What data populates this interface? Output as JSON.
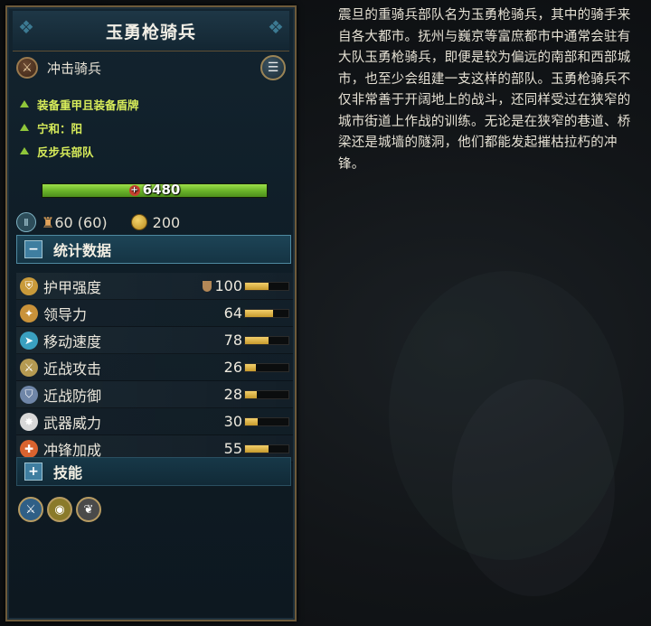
{
  "unit": {
    "name": "玉勇枪骑兵",
    "type": "冲击骑兵",
    "type_icon": "cavalry-charge-icon",
    "menu_icon": "list-menu-icon",
    "traits": [
      "装备重甲且装备盾牌",
      "宁和：阳",
      "反步兵部队"
    ],
    "health": "6480",
    "health_fraction": 1.0,
    "upkeep": "60 (60)",
    "cost": "200"
  },
  "sections": {
    "stats_label": "统计数据",
    "skills_label": "技能"
  },
  "stats": [
    {
      "label": "护甲强度",
      "value": "100",
      "fill": 0.55,
      "icon": "armor-icon",
      "color": "#c99a3a"
    },
    {
      "label": "领导力",
      "value": "64",
      "fill": 0.64,
      "icon": "leadership-icon",
      "color": "#c9923a"
    },
    {
      "label": "移动速度",
      "value": "78",
      "fill": 0.55,
      "icon": "speed-icon",
      "color": "#3aa0c0"
    },
    {
      "label": "近战攻击",
      "value": "26",
      "fill": 0.26,
      "icon": "melee-attack-icon",
      "color": "#b59a52"
    },
    {
      "label": "近战防御",
      "value": "28",
      "fill": 0.28,
      "icon": "melee-defense-icon",
      "color": "#6f86a8"
    },
    {
      "label": "武器威力",
      "value": "30",
      "fill": 0.3,
      "icon": "weapon-strength-icon",
      "color": "#d8d8d8"
    },
    {
      "label": "冲锋加成",
      "value": "55",
      "fill": 0.55,
      "icon": "charge-bonus-icon",
      "color": "#d9632f"
    }
  ],
  "abilities": [
    {
      "icon": "sword-ability-icon",
      "color": "#2f5f86"
    },
    {
      "icon": "eye-ability-icon",
      "color": "#8a7a2a"
    },
    {
      "icon": "feather-ability-icon",
      "color": "#4a4a4a"
    }
  ],
  "description": "震旦的重骑兵部队名为玉勇枪骑兵，其中的骑手来自各大都市。抚州与巍京等富庶都市中通常会驻有大队玉勇枪骑兵，即便是较为偏远的南部和西部城市，也至少会组建一支这样的部队。玉勇枪骑兵不仅非常善于开阔地上的战斗，还同样受过在狭窄的城市街道上作战的训练。无论是在狭窄的巷道、桥梁还是城墙的隧洞，他们都能发起摧枯拉朽的冲锋。"
}
